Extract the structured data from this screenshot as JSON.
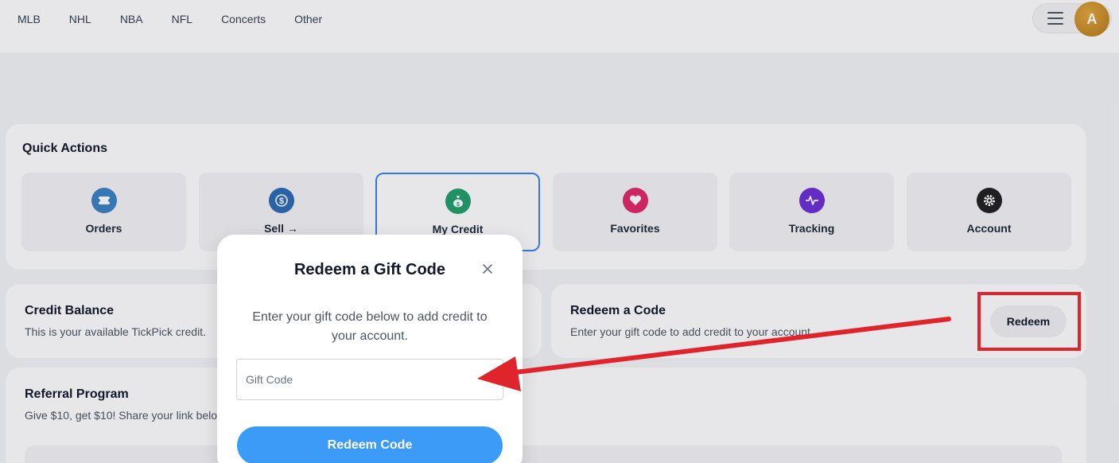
{
  "nav": {
    "links": [
      "MLB",
      "NHL",
      "NBA",
      "NFL",
      "Concerts",
      "Other"
    ]
  },
  "user": {
    "avatar_letter": "A"
  },
  "quick_actions": {
    "title": "Quick Actions",
    "items": [
      {
        "label": "Orders",
        "icon": "ticket-icon",
        "color": "#3b82c4"
      },
      {
        "label": "Sell →",
        "icon": "dollar-cycle-icon",
        "color": "#2d6bb5"
      },
      {
        "label": "My Credit",
        "icon": "money-bag-icon",
        "color": "#22a06b"
      },
      {
        "label": "Favorites",
        "icon": "heart-icon",
        "color": "#e0286a"
      },
      {
        "label": "Tracking",
        "icon": "pulse-icon",
        "color": "#6d2fd6"
      },
      {
        "label": "Account",
        "icon": "gear-icon",
        "color": "#222222"
      }
    ]
  },
  "credit_balance": {
    "title": "Credit Balance",
    "description": "This is your available TickPick credit."
  },
  "redeem_section": {
    "title": "Redeem a Code",
    "description": "Enter your gift code to add credit to your account.",
    "button": "Redeem"
  },
  "referral": {
    "title": "Referral Program",
    "description": "Give $10, get $10! Share your link below."
  },
  "modal": {
    "title": "Redeem a Gift Code",
    "description": "Enter your gift code below to add credit to your account.",
    "input_placeholder": "Gift Code",
    "input_value": "",
    "submit_label": "Redeem Code"
  },
  "colors": {
    "accent": "#3b9bf6",
    "annotation": "#e0242b",
    "active_border": "#3b82f6"
  }
}
